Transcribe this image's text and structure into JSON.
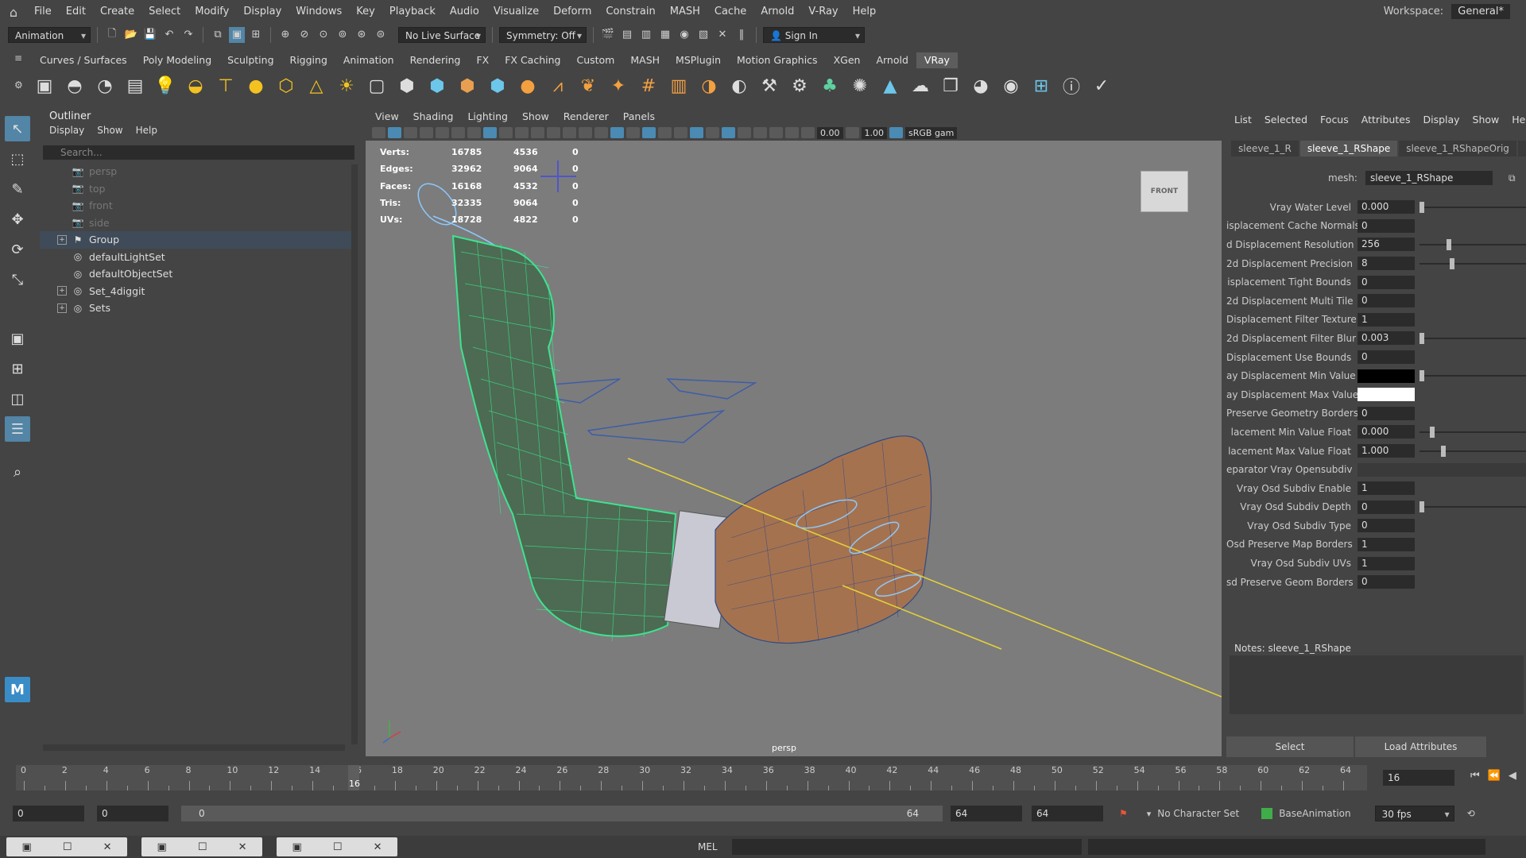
{
  "menubar": {
    "items": [
      "File",
      "Edit",
      "Create",
      "Select",
      "Modify",
      "Display",
      "Windows",
      "Key",
      "Playback",
      "Audio",
      "Visualize",
      "Deform",
      "Constrain",
      "MASH",
      "Cache",
      "Arnold",
      "V-Ray",
      "Help"
    ],
    "workspace_label": "Workspace:",
    "workspace_value": "General*"
  },
  "statusline": {
    "mode": "Animation",
    "live_surface": "No Live Surface",
    "symmetry": "Symmetry: Off",
    "sign_in": "Sign In"
  },
  "shelf": {
    "tabs": [
      "Curves / Surfaces",
      "Poly Modeling",
      "Sculpting",
      "Rigging",
      "Animation",
      "Rendering",
      "FX",
      "FX Caching",
      "Custom",
      "MASH",
      "MSPlugin",
      "Motion Graphics",
      "XGen",
      "Arnold",
      "VRay"
    ],
    "active_tab": "VRay"
  },
  "outliner": {
    "title": "Outliner",
    "menu": [
      "Display",
      "Show",
      "Help"
    ],
    "search_placeholder": "Search...",
    "items": [
      {
        "label": "persp",
        "icon": "camera-icon",
        "dim": true
      },
      {
        "label": "top",
        "icon": "camera-icon",
        "dim": true
      },
      {
        "label": "front",
        "icon": "camera-icon",
        "dim": true
      },
      {
        "label": "side",
        "icon": "camera-icon",
        "dim": true
      },
      {
        "label": "Group",
        "icon": "group-icon",
        "selected": true,
        "expandable": true
      },
      {
        "label": "defaultLightSet",
        "icon": "set-icon"
      },
      {
        "label": "defaultObjectSet",
        "icon": "set-icon"
      },
      {
        "label": "Set_4diggit",
        "icon": "set-icon",
        "expandable": true
      },
      {
        "label": "Sets",
        "icon": "set-icon",
        "expandable": true
      }
    ]
  },
  "viewport": {
    "menu": [
      "View",
      "Shading",
      "Lighting",
      "Show",
      "Renderer",
      "Panels"
    ],
    "exposure": "0.00",
    "gamma": "1.00",
    "color_space": "sRGB gam",
    "camera_label": "persp",
    "view_cube_label": "FRONT",
    "hud": [
      {
        "label": "Verts:",
        "a": "16785",
        "b": "4536",
        "c": "0"
      },
      {
        "label": "Edges:",
        "a": "32962",
        "b": "9064",
        "c": "0"
      },
      {
        "label": "Faces:",
        "a": "16168",
        "b": "4532",
        "c": "0"
      },
      {
        "label": "Tris:",
        "a": "32335",
        "b": "9064",
        "c": "0"
      },
      {
        "label": "UVs:",
        "a": "18728",
        "b": "4822",
        "c": "0"
      }
    ]
  },
  "attribute_editor": {
    "menu": [
      "List",
      "Selected",
      "Focus",
      "Attributes",
      "Display",
      "Show",
      "Help"
    ],
    "tabs": [
      "sleeve_1_R",
      "sleeve_1_RShape",
      "sleeve_1_RShapeOrig",
      "Re"
    ],
    "active_tab": "sleeve_1_RShape",
    "mesh_label": "mesh:",
    "mesh_value": "sleeve_1_RShape",
    "attributes": [
      {
        "label": "Vray Water Level",
        "value": "0.000",
        "slider": 0.0
      },
      {
        "label": "isplacement Cache Normals",
        "value": "0"
      },
      {
        "label": "d Displacement Resolution",
        "value": "256",
        "slider": 0.25
      },
      {
        "label": "2d Displacement Precision",
        "value": "8",
        "slider": 0.28
      },
      {
        "label": "isplacement Tight Bounds",
        "value": "0"
      },
      {
        "label": "2d Displacement Multi Tile",
        "value": "0"
      },
      {
        "label": "Displacement Filter Texture",
        "value": "1"
      },
      {
        "label": "2d Displacement Filter Blur",
        "value": "0.003",
        "slider": 0.0
      },
      {
        "label": "Displacement Use Bounds",
        "value": "0"
      },
      {
        "label": "ay Displacement Min Value",
        "value": "",
        "swatch": "black",
        "slider": 0.0
      },
      {
        "label": "ay Displacement Max Value",
        "value": "",
        "swatch": "white"
      },
      {
        "label": "Preserve Geometry Borders",
        "value": "0"
      },
      {
        "label": "lacement Min Value Float",
        "value": "0.000",
        "slider": 0.1
      },
      {
        "label": "lacement Max Value Float",
        "value": "1.000",
        "slider": 0.2
      },
      {
        "label": "eparator Vray Opensubdiv",
        "value": "",
        "header": true
      },
      {
        "label": "Vray Osd Subdiv Enable",
        "value": "1"
      },
      {
        "label": "Vray Osd Subdiv Depth",
        "value": "0",
        "slider": 0.0
      },
      {
        "label": "Vray Osd Subdiv Type",
        "value": "0"
      },
      {
        "label": "Osd Preserve Map Borders",
        "value": "1"
      },
      {
        "label": "Vray Osd Subdiv UVs",
        "value": "1"
      },
      {
        "label": "sd Preserve Geom Borders",
        "value": "0"
      }
    ],
    "notes_label": "Notes:  sleeve_1_RShape",
    "buttons": [
      "Select",
      "Load Attributes"
    ]
  },
  "timeline": {
    "ticks": [
      "0",
      "2",
      "4",
      "6",
      "8",
      "10",
      "12",
      "14",
      "16",
      "18",
      "20",
      "22",
      "24",
      "26",
      "28",
      "30",
      "32",
      "34",
      "36",
      "38",
      "40",
      "42",
      "44",
      "46",
      "48",
      "50",
      "52",
      "54",
      "56",
      "58",
      "60",
      "62",
      "64"
    ],
    "current_frame": "16",
    "current_frame_field": "16"
  },
  "range": {
    "start": "0",
    "anim_start": "0",
    "slider_start": "0",
    "slider_end": "64",
    "anim_end": "64",
    "end": "64",
    "character_set": "No Character Set",
    "anim_layer": "BaseAnimation",
    "fps": "30 fps"
  },
  "commandline": {
    "mel_label": "MEL"
  },
  "colors": {
    "accent": "#5285a6",
    "wire_green": "#3ee38f",
    "curve_blue": "#8cc9ff"
  }
}
